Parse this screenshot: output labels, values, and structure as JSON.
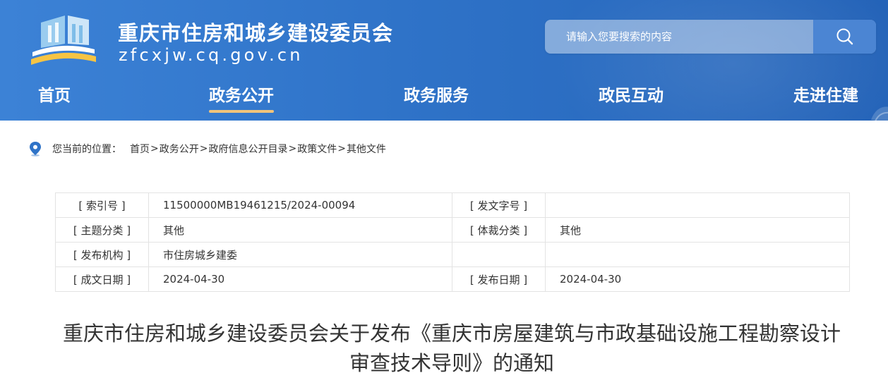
{
  "header": {
    "site_title": "重庆市住房和城乡建设委员会",
    "site_domain": "zfcxjw.cq.gov.cn",
    "search_placeholder": "请输入您要搜索的内容",
    "search_icon": "search-icon",
    "nav": [
      {
        "label": "首页",
        "active": false
      },
      {
        "label": "政务公开",
        "active": true
      },
      {
        "label": "政务服务",
        "active": false
      },
      {
        "label": "政民互动",
        "active": false
      },
      {
        "label": "走进住建",
        "active": false
      }
    ],
    "colors": {
      "bar": "#2f73c8",
      "active_underline": "#f1c47a"
    }
  },
  "breadcrumb": {
    "prefix": "您当前的位置：",
    "icon": "location-pin-icon",
    "items": [
      "首页",
      "政务公开",
      "政府信息公开目录",
      "政策文件",
      "其他文件"
    ],
    "separator": ">"
  },
  "info": {
    "rows": [
      {
        "l1": "[ 索引号 ]",
        "v1": "11500000MB19461215/2024-00094",
        "l2": "[ 发文字号 ]",
        "v2": ""
      },
      {
        "l1": "[ 主题分类 ]",
        "v1": "其他",
        "l2": "[ 体裁分类 ]",
        "v2": "其他"
      },
      {
        "l1": "[ 发布机构 ]",
        "v1": "市住房城乡建委",
        "l2": "",
        "v2": ""
      },
      {
        "l1": "[ 成文日期 ]",
        "v1": "2024-04-30",
        "l2": "[ 发布日期 ]",
        "v2": "2024-04-30"
      }
    ]
  },
  "article": {
    "title_line1": "重庆市住房和城乡建设委员会关于发布《重庆市房屋建筑与市政基础设施工程勘察设计",
    "title_line2": "审查技术导则》的通知"
  }
}
